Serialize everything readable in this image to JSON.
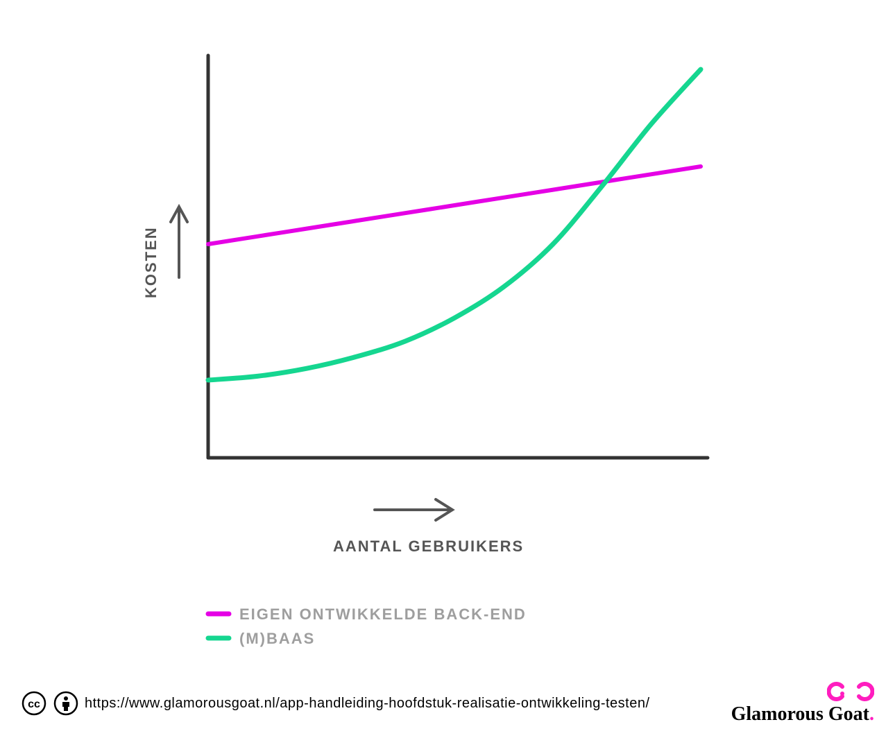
{
  "chart_data": {
    "type": "line",
    "title": "",
    "xlabel": "AANTAL GEBRUIKERS",
    "ylabel": "KOSTEN",
    "xlim": [
      0,
      100
    ],
    "ylim": [
      0,
      100
    ],
    "grid": false,
    "legend_position": "bottom",
    "series": [
      {
        "name": "EIGEN ONTWIKKELDE BACK-END",
        "color": "#e500e5",
        "x": [
          0,
          10,
          20,
          30,
          40,
          50,
          60,
          70,
          80,
          90,
          100
        ],
        "values": [
          55,
          57,
          59,
          61,
          63,
          65,
          67,
          69,
          71,
          73,
          75
        ]
      },
      {
        "name": "(M)BAAS",
        "color": "#15d690",
        "x": [
          0,
          10,
          20,
          30,
          40,
          50,
          60,
          70,
          80,
          90,
          100
        ],
        "values": [
          20,
          21,
          23,
          26,
          30,
          36,
          44,
          55,
          70,
          86,
          100
        ]
      }
    ]
  },
  "footer": {
    "url": "https://www.glamorousgoat.nl/app-handleiding-hoofdstuk-realisatie-ontwikkeling-testen/",
    "brand": "Glamorous Goat"
  },
  "colors": {
    "axis": "#333333",
    "label": "#555555",
    "legend_text": "#9e9e9e",
    "series1": "#e500e5",
    "series2": "#15d690",
    "brand_accent": "#ff1dbf"
  }
}
